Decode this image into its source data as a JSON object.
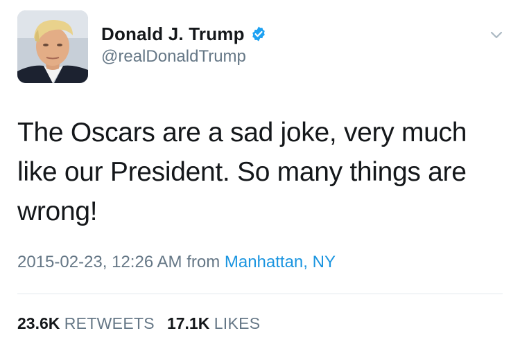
{
  "user": {
    "display_name": "Donald J. Trump",
    "handle": "@realDonaldTrump",
    "verified": true,
    "avatar_icon": "profile-photo"
  },
  "tweet": {
    "text": "The Oscars are a sad joke, very much like our President. So many things are wrong!",
    "timestamp": "2015-02-23, 12:26 AM",
    "from_label": "from",
    "location": "Manhattan, NY"
  },
  "stats": {
    "retweets_count": "23.6K",
    "retweets_label": "RETWEETS",
    "likes_count": "17.1K",
    "likes_label": "LIKES"
  },
  "icons": {
    "verified": "verified-badge-icon",
    "menu": "chevron-down-icon"
  },
  "colors": {
    "text_primary": "#14171a",
    "text_secondary": "#657786",
    "link": "#1b95e0",
    "verified_badge": "#1da1f2",
    "divider": "#e1e8ed"
  }
}
